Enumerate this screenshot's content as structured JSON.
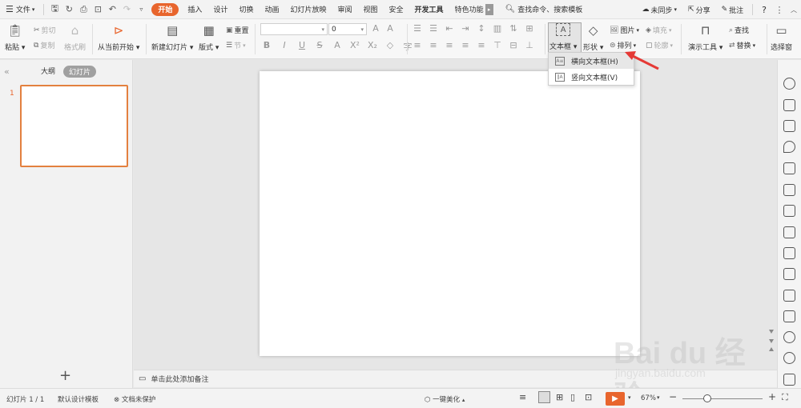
{
  "menubar": {
    "file_label": "文件",
    "tabs": [
      "开始",
      "插入",
      "设计",
      "切换",
      "动画",
      "幻灯片放映",
      "审阅",
      "视图",
      "安全",
      "开发工具",
      "特色功能"
    ],
    "search_label": "查找命令、搜索模板",
    "sync_label": "未同步",
    "share_label": "分享",
    "comment_label": "批注",
    "help_label": "?"
  },
  "ribbon": {
    "paste": "粘贴",
    "cut": "剪切",
    "copy": "复制",
    "format_painter": "格式刷",
    "from_current": "从当前开始",
    "new_slide": "新建幻灯片",
    "layout": "版式",
    "reset": "重置",
    "section": "节",
    "font_size_value": "0",
    "textbox": "文本框",
    "shape": "形状",
    "picture": "图片",
    "fill": "填充",
    "arrange": "排列",
    "outline": "轮廓",
    "present_tools": "演示工具",
    "find": "查找",
    "replace": "替换",
    "select_pane": "选择窗"
  },
  "dropdown": {
    "items": [
      "横向文本框(H)",
      "竖向文本框(V)"
    ]
  },
  "leftpanel": {
    "tab_outline": "大纲",
    "tab_slides": "幻灯片",
    "slide_number": "1",
    "add": "+"
  },
  "notes": {
    "placeholder": "单击此处添加备注"
  },
  "status": {
    "slide_count": "幻灯片 1 / 1",
    "template": "默认设计模板",
    "protect": "文档未保护",
    "beautify": "一键美化",
    "zoom": "67%"
  },
  "watermark": {
    "brand": "Bai du 经验",
    "url": "jingyan.baidu.com"
  },
  "colors": {
    "accent": "#e8652d",
    "thumb_border": "#e3803f",
    "arrow": "#e53935"
  }
}
